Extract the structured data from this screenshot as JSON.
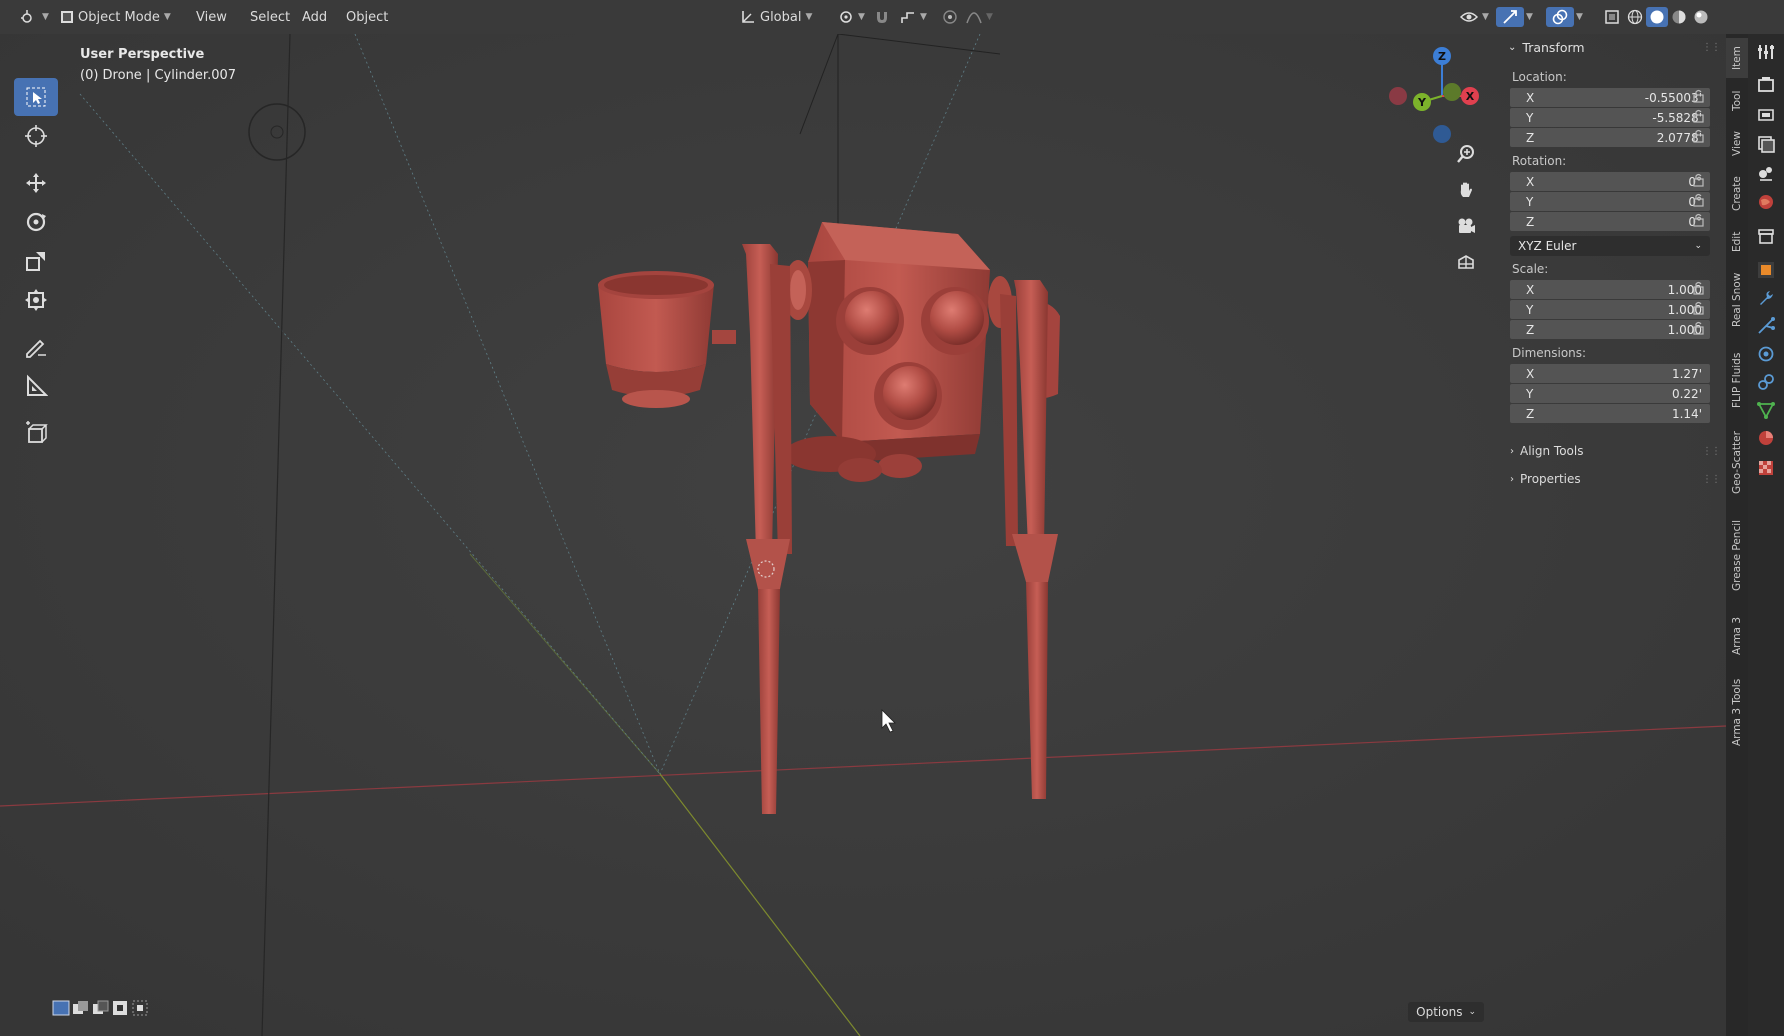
{
  "header": {
    "mode": "Object Mode",
    "menus": [
      "View",
      "Select",
      "Add",
      "Object"
    ],
    "orientation": "Global"
  },
  "viewport": {
    "perspective": "User Perspective",
    "object_info": "(0) Drone | Cylinder.007"
  },
  "panel": {
    "title": "Transform",
    "location_label": "Location:",
    "location": [
      {
        "axis": "X",
        "value": "-0.55003'"
      },
      {
        "axis": "Y",
        "value": "-5.5828'"
      },
      {
        "axis": "Z",
        "value": "2.0778'"
      }
    ],
    "rotation_label": "Rotation:",
    "rotation": [
      {
        "axis": "X",
        "value": "0°"
      },
      {
        "axis": "Y",
        "value": "0°"
      },
      {
        "axis": "Z",
        "value": "0°"
      }
    ],
    "rotation_mode": "XYZ Euler",
    "scale_label": "Scale:",
    "scale": [
      {
        "axis": "X",
        "value": "1.000"
      },
      {
        "axis": "Y",
        "value": "1.000"
      },
      {
        "axis": "Z",
        "value": "1.000"
      }
    ],
    "dimensions_label": "Dimensions:",
    "dimensions": [
      {
        "axis": "X",
        "value": "1.27'"
      },
      {
        "axis": "Y",
        "value": "0.22'"
      },
      {
        "axis": "Z",
        "value": "1.14'"
      }
    ],
    "align_tools": "Align Tools",
    "properties": "Properties"
  },
  "vtabs": [
    "Item",
    "Tool",
    "View",
    "Create",
    "Edit",
    "Real Snow",
    "FLIP Fluids",
    "Geo-Scatter",
    "Grease Pencil",
    "Arma 3",
    "Arma 3 Tools"
  ],
  "gizmo": {
    "x": "X",
    "y": "Y",
    "z": "Z"
  },
  "footer": {
    "options": "Options"
  },
  "colors": {
    "accent": "#4772b3",
    "model": "#b5524a",
    "axis_x": "#e0404f",
    "axis_y": "#7cb32b",
    "axis_z": "#3c7ed6"
  }
}
